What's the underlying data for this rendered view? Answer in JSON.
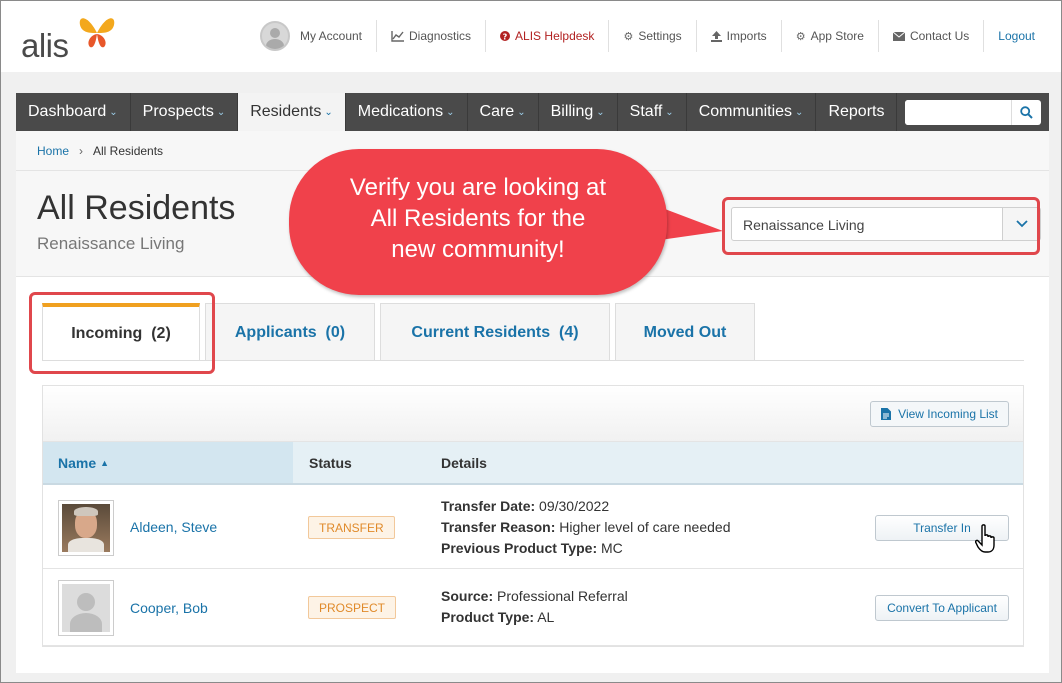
{
  "brand": {
    "logo_text": "alis"
  },
  "toplinks": {
    "my_account": "My Account",
    "diagnostics": "Diagnostics",
    "helpdesk": "ALIS Helpdesk",
    "settings": "Settings",
    "imports": "Imports",
    "app_store": "App Store",
    "contact_us": "Contact Us",
    "logout": "Logout"
  },
  "nav": {
    "items": [
      {
        "label": "Dashboard"
      },
      {
        "label": "Prospects"
      },
      {
        "label": "Residents"
      },
      {
        "label": "Medications"
      },
      {
        "label": "Care"
      },
      {
        "label": "Billing"
      },
      {
        "label": "Staff"
      },
      {
        "label": "Communities"
      },
      {
        "label": "Reports"
      }
    ],
    "search_value": ""
  },
  "breadcrumb": {
    "home": "Home",
    "current": "All Residents"
  },
  "header": {
    "title": "All Residents",
    "subtitle": "Renaissance Living",
    "community_selected": "Renaissance Living"
  },
  "callout": {
    "line1": "Verify you are looking at",
    "line2": "All Residents for the",
    "line3": "new community!"
  },
  "tabs": [
    {
      "label": "Incoming  (2)"
    },
    {
      "label": "Applicants  (0)"
    },
    {
      "label": "Current Residents  (4)"
    },
    {
      "label": "Moved Out"
    }
  ],
  "toolbar": {
    "view_list": "View Incoming List"
  },
  "table": {
    "headers": {
      "name": "Name",
      "status": "Status",
      "details": "Details"
    },
    "rows": [
      {
        "name": "Aldeen, Steve",
        "status": "TRANSFER",
        "d1_label": "Transfer Date:",
        "d1_value": "09/30/2022",
        "d2_label": "Transfer Reason:",
        "d2_value": "Higher level of care needed",
        "d3_label": "Previous Product Type:",
        "d3_value": "MC",
        "action": "Transfer In"
      },
      {
        "name": "Cooper, Bob",
        "status": "PROSPECT",
        "d1_label": "Source:",
        "d1_value": "Professional Referral",
        "d2_label": "Product Type:",
        "d2_value": "AL",
        "action": "Convert To Applicant"
      }
    ]
  },
  "colors": {
    "accent": "#1a73a8",
    "nav_bg": "#4a4a4a",
    "callout": "#f0414b",
    "highlight": "#e0474c",
    "tab_active_bar": "#f0a020",
    "badge_text": "#e08a2a"
  }
}
